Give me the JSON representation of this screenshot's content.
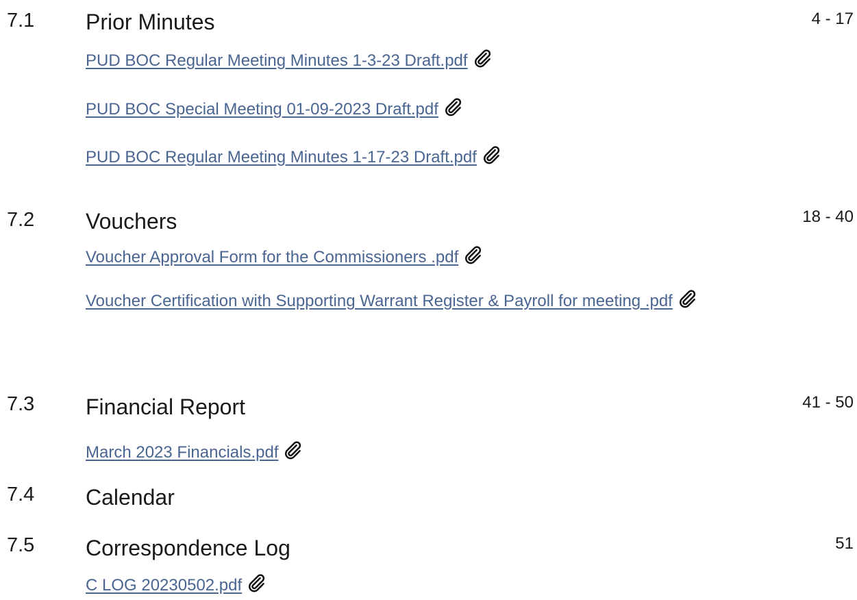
{
  "items": [
    {
      "number": "7.1",
      "title": "Prior Minutes",
      "pages": "4 - 17",
      "attachments": [
        {
          "label": "PUD BOC Regular Meeting Minutes 1-3-23 Draft.pdf",
          "icon": "paperclip-icon"
        },
        {
          "label": "PUD BOC Special Meeting 01-09-2023 Draft.pdf",
          "icon": "paperclip-icon"
        },
        {
          "label": "PUD BOC Regular Meeting Minutes 1-17-23 Draft.pdf",
          "icon": "paperclip-icon"
        }
      ]
    },
    {
      "number": "7.2",
      "title": "Vouchers",
      "pages": "18 - 40",
      "attachments": [
        {
          "label": "Voucher Approval Form for the Commissioners .pdf",
          "icon": "paperclip-icon"
        },
        {
          "label": "Voucher Certification with Supporting Warrant Register & Payroll for meeting .pdf",
          "icon": "paperclip-icon"
        }
      ]
    },
    {
      "number": "7.3",
      "title": "Financial Report",
      "pages": "41 - 50",
      "attachments": [
        {
          "label": "March 2023 Financials.pdf",
          "icon": "paperclip-icon"
        }
      ]
    },
    {
      "number": "7.4",
      "title": "Calendar",
      "pages": "",
      "attachments": []
    },
    {
      "number": "7.5",
      "title": "Correspondence Log",
      "pages": "51",
      "attachments": [
        {
          "label": "C LOG 20230502.pdf",
          "icon": "paperclip-icon"
        }
      ]
    }
  ],
  "colors": {
    "link": "#4a6591",
    "text": "#1a1a1a"
  }
}
